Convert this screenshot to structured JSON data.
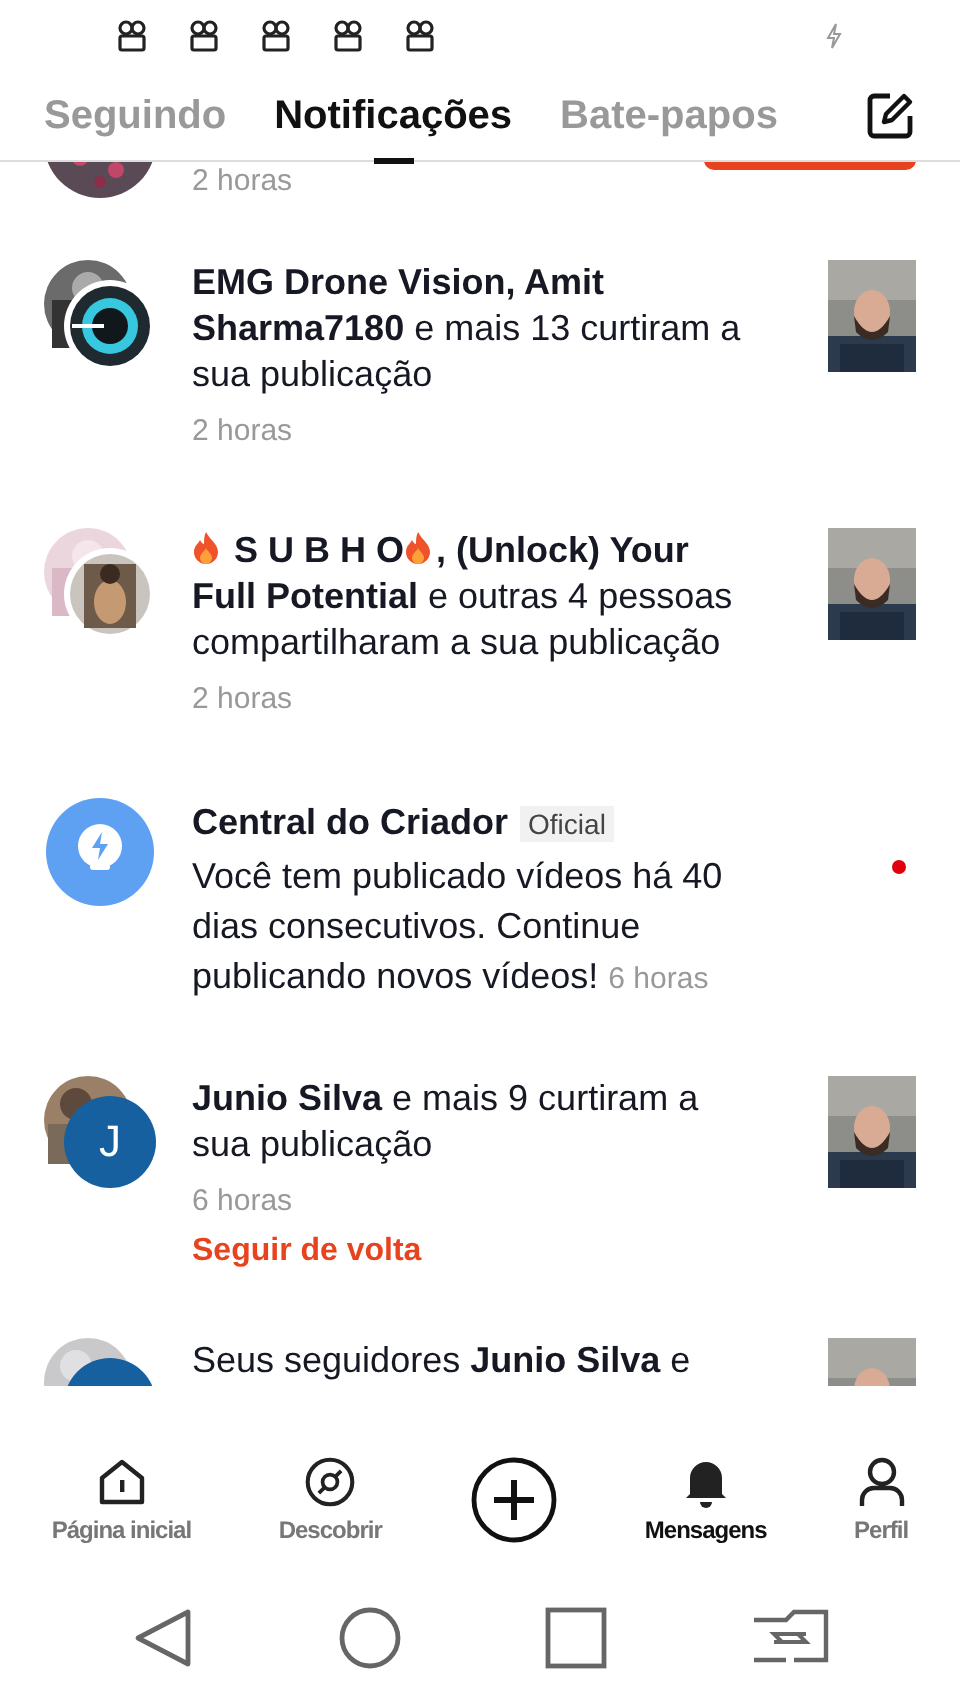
{
  "status_bar": {
    "notification_icons": [
      {
        "kind": "reel"
      },
      {
        "kind": "reel"
      },
      {
        "kind": "reel"
      },
      {
        "kind": "reel"
      },
      {
        "kind": "reel"
      }
    ]
  },
  "tabs": [
    {
      "label": "Seguindo",
      "selected": false
    },
    {
      "label": "Notificações",
      "selected": true
    },
    {
      "label": "Bate-papos",
      "selected": false
    }
  ],
  "notifications": [
    {
      "kind": "partial",
      "time": "2 horas",
      "avatar": {
        "kind": "picture"
      }
    },
    {
      "kind": "activity",
      "avatar": {
        "kind": "stack"
      },
      "segments": [
        {
          "kind": "text",
          "text": "**EMG Drone Vision, Amit Sharma7180** e mais 13 curtiram a sua publicação"
        }
      ],
      "time": "2 horas",
      "thumbnail": {
        "kind": "picture"
      }
    },
    {
      "kind": "activity",
      "avatar": {
        "kind": "stack"
      },
      "segments": [
        {
          "kind": "flame"
        },
        {
          "kind": "text",
          "text": " **S U B H O**"
        },
        {
          "kind": "flame"
        },
        {
          "kind": "text",
          "text": "**, (Unlock) Your Full Potential** e outras 4 pessoas compartilharam a sua publicação"
        }
      ],
      "time": "2 horas",
      "thumbnail": {
        "kind": "picture"
      }
    },
    {
      "kind": "system",
      "avatar": {
        "kind": "creator"
      },
      "sender": "Central do Criador",
      "badge": "Oficial",
      "message": "Você tem publicado vídeos há 40 dias consecutivos. Continue publicando novos vídeos!",
      "time": "6 horas",
      "unread": true
    },
    {
      "kind": "activity",
      "avatar": {
        "kind": "letter",
        "letter": "J"
      },
      "segments": [
        {
          "kind": "text",
          "text": "**Junio Silva** e mais 9 curtiram a sua publicação"
        }
      ],
      "time": "6 horas",
      "action": "Seguir de volta",
      "thumbnail": {
        "kind": "picture"
      }
    },
    {
      "kind": "cut",
      "avatar": {
        "kind": "letter"
      },
      "segments": [
        {
          "kind": "text",
          "text": "Seus seguidores **Junio Silva** e"
        }
      ],
      "thumbnail": {
        "kind": "picture"
      }
    }
  ],
  "bottom_nav": [
    {
      "kind": "home",
      "label": "Página inicial",
      "selected": false
    },
    {
      "kind": "discover",
      "label": "Descobrir",
      "selected": false
    },
    {
      "kind": "create"
    },
    {
      "kind": "bell",
      "label": "Mensagens",
      "selected": true
    },
    {
      "kind": "profile",
      "label": "Perfil",
      "selected": false
    }
  ],
  "system_nav": [
    {
      "kind": "back"
    },
    {
      "kind": "home"
    },
    {
      "kind": "recents"
    },
    {
      "kind": "switch"
    }
  ]
}
